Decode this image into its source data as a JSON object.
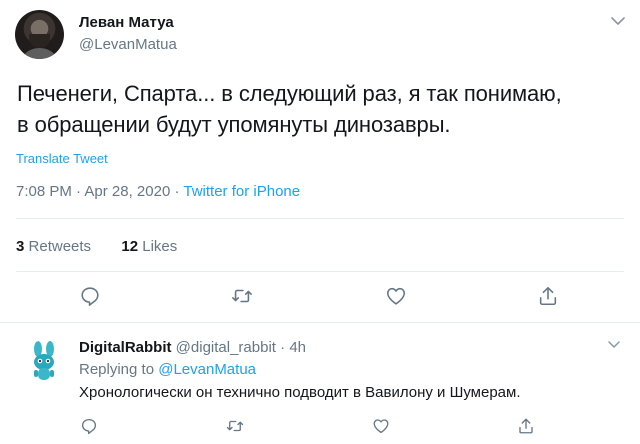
{
  "tweet": {
    "author": {
      "name": "Леван Матуа",
      "handle": "@LevanMatua"
    },
    "text_line1": "Печенеги, Спарта... в следующий раз, я так понимаю,",
    "text_line2": "в обращении будут упомянуты динозавры.",
    "translate_label": "Translate Tweet",
    "time": "7:08 PM",
    "date": "Apr 28, 2020",
    "separator": "·",
    "source": "Twitter for iPhone",
    "retweets": {
      "count": "3",
      "label": "Retweets"
    },
    "likes": {
      "count": "12",
      "label": "Likes"
    },
    "icons": [
      "reply-icon",
      "retweet-icon",
      "like-icon",
      "share-icon",
      "caret-down-icon"
    ]
  },
  "reply": {
    "name": "DigitalRabbit",
    "handle": "@digital_rabbit",
    "separator": "·",
    "age": "4h",
    "replying_prefix": "Replying to",
    "replying_mention": "@LevanMatua",
    "text": "Хронологически он технично подводит в Вавилону и Шумерам."
  },
  "colors": {
    "accent": "#1da1f2",
    "text": "#14171a",
    "muted": "#657786",
    "divider": "#e6ecf0"
  }
}
